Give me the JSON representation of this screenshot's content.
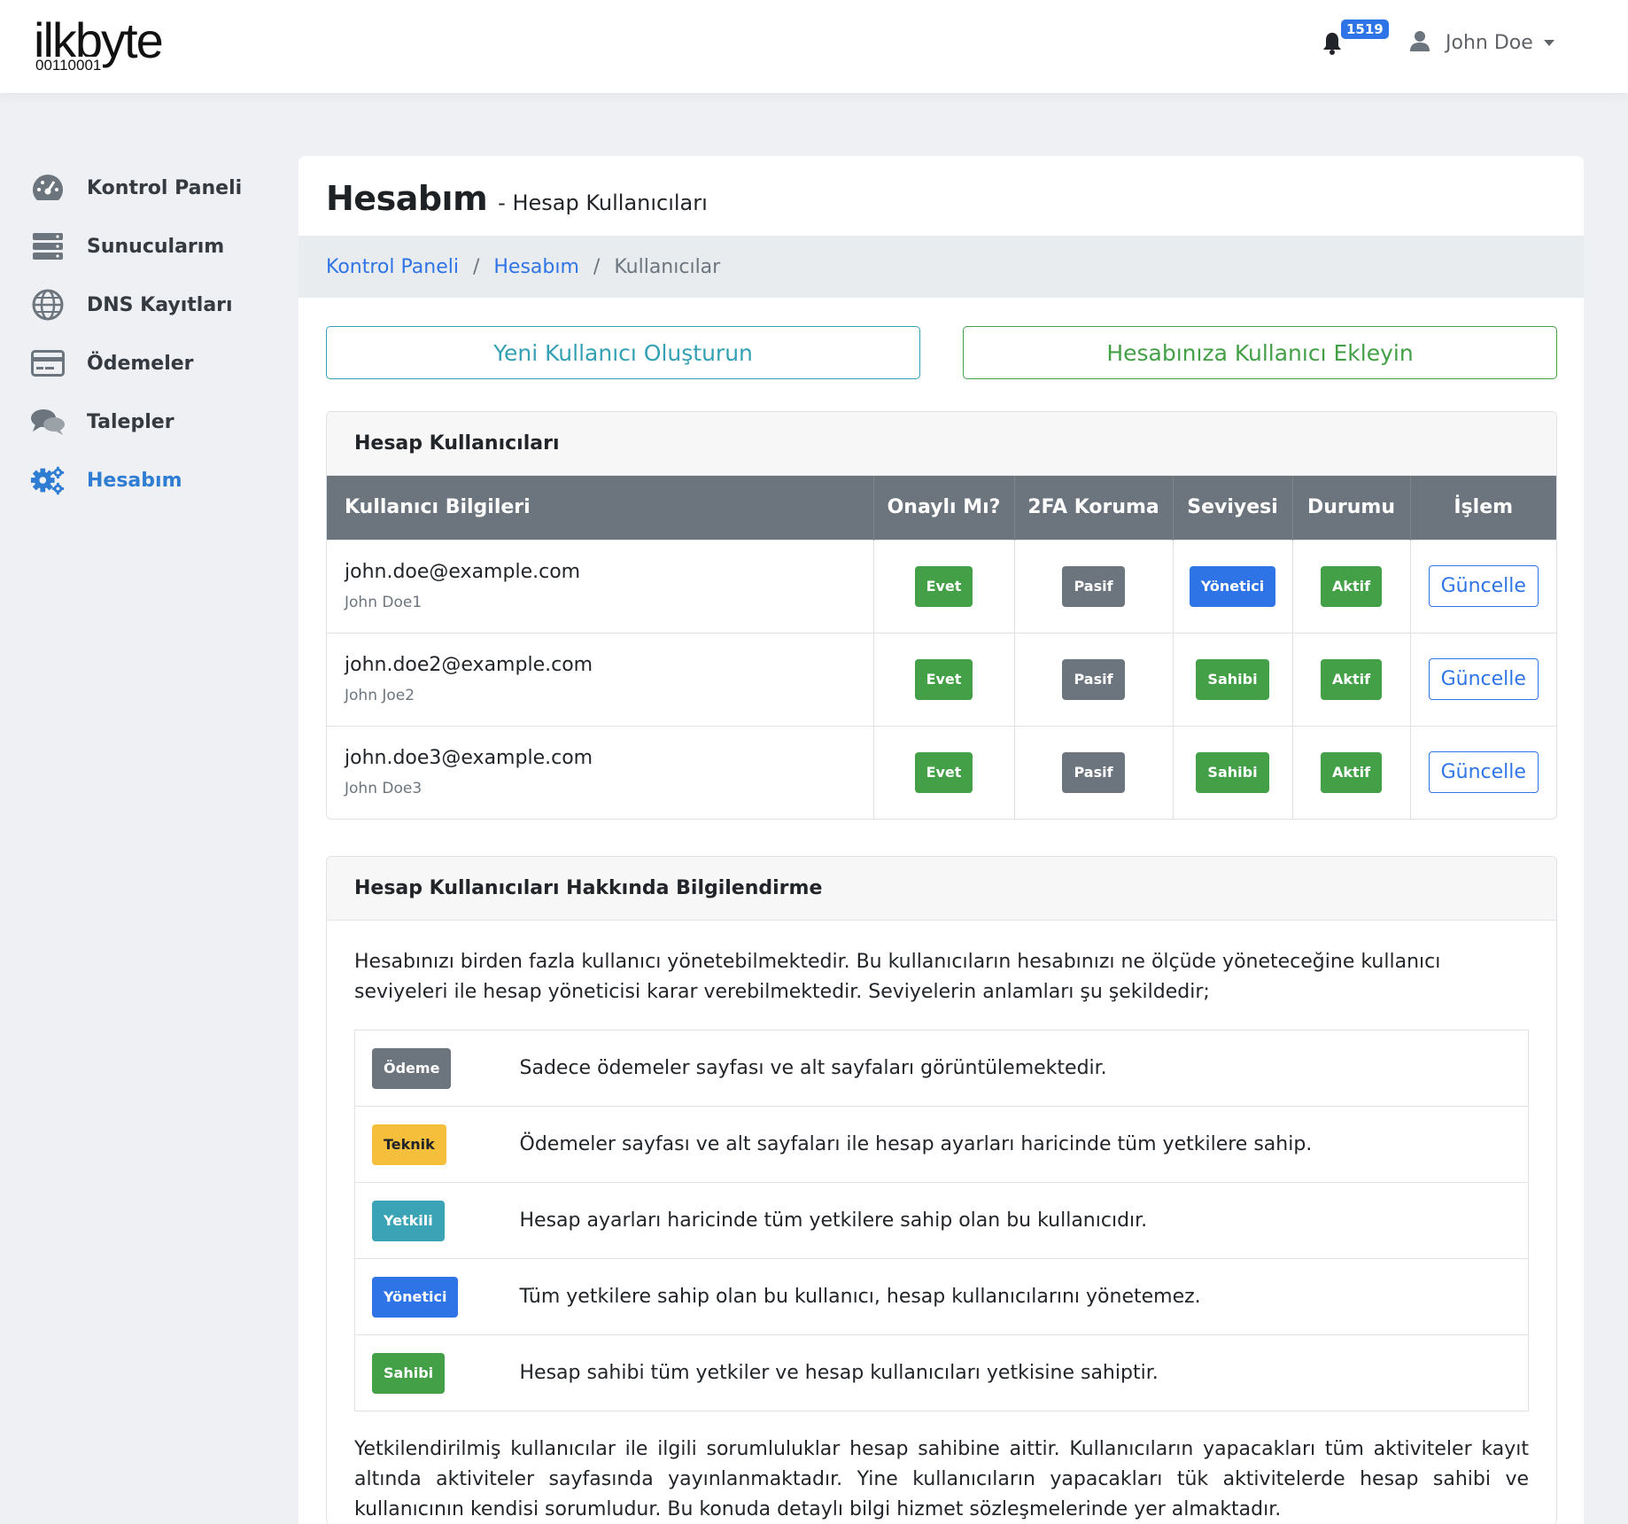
{
  "header": {
    "logo_text": "ilkbyte",
    "logo_subtext": "00110001",
    "notification_count": "1519",
    "user_name": "John Doe"
  },
  "sidebar": {
    "items": [
      {
        "label": "Kontrol Paneli",
        "icon": "dashboard-icon"
      },
      {
        "label": "Sunucularım",
        "icon": "server-icon"
      },
      {
        "label": "DNS Kayıtları",
        "icon": "globe-icon"
      },
      {
        "label": "Ödemeler",
        "icon": "credit-card-icon"
      },
      {
        "label": "Talepler",
        "icon": "comments-icon"
      },
      {
        "label": "Hesabım",
        "icon": "gears-icon",
        "active": true
      }
    ]
  },
  "page": {
    "title": "Hesabım",
    "subtitle": "- Hesap Kullanıcıları",
    "breadcrumb": [
      "Kontrol Paneli",
      "Hesabım",
      "Kullanıcılar"
    ],
    "buttons": {
      "create_user": "Yeni Kullanıcı Oluşturun",
      "add_user": "Hesabınıza Kullanıcı Ekleyin"
    }
  },
  "users_panel": {
    "title": "Hesap Kullanıcıları",
    "columns": [
      "Kullanıcı Bilgileri",
      "Onaylı Mı?",
      "2FA Koruma",
      "Seviyesi",
      "Durumu",
      "İşlem"
    ],
    "rows": [
      {
        "email": "john.doe@example.com",
        "name": "John Doe1",
        "approved": "Evet",
        "twofa": "Pasif",
        "level": "Yönetici",
        "status": "Aktif",
        "action": "Güncelle"
      },
      {
        "email": "john.doe2@example.com",
        "name": "John Joe2",
        "approved": "Evet",
        "twofa": "Pasif",
        "level": "Sahibi",
        "status": "Aktif",
        "action": "Güncelle"
      },
      {
        "email": "john.doe3@example.com",
        "name": "John Doe3",
        "approved": "Evet",
        "twofa": "Pasif",
        "level": "Sahibi",
        "status": "Aktif",
        "action": "Güncelle"
      }
    ]
  },
  "info_panel": {
    "title": "Hesap Kullanıcıları Hakkında Bilgilendirme",
    "intro": "Hesabınızı birden fazla kullanıcı yönetebilmektedir. Bu kullanıcıların hesabınızı ne ölçüde yöneteceğine kullanıcı seviyeleri ile hesap yöneticisi karar verebilmektedir. Seviyelerin anlamları şu şekildedir;",
    "levels": [
      {
        "badge": "Ödeme",
        "text": "Sadece ödemeler sayfası ve alt sayfaları görüntülemektedir."
      },
      {
        "badge": "Teknik",
        "text": "Ödemeler sayfası ve alt sayfaları ile hesap ayarları haricinde tüm yetkilere sahip."
      },
      {
        "badge": "Yetkili",
        "text": "Hesap ayarları haricinde tüm yetkilere sahip olan bu kullanıcıdır."
      },
      {
        "badge": "Yönetici",
        "text": "Tüm yetkilere sahip olan bu kullanıcı, hesap kullanıcılarını yönetemez."
      },
      {
        "badge": "Sahibi",
        "text": "Hesap sahibi tüm yetkiler ve hesap kullanıcıları yetkisine sahiptir."
      }
    ],
    "footer": "Yetkilendirilmiş kullanıcılar ile ilgili sorumluluklar hesap sahibine aittir. Kullanıcıların yapacakları tüm aktiviteler kayıt altında aktiviteler sayfasında yayınlanmaktadır. Yine kullanıcıların yapacakları tük aktivitelerde hesap sahibi ve kullanıcının kendisi sorumludur. Bu konuda detaylı bilgi hizmet sözleşmelerinde yer almaktadır."
  },
  "colors": {
    "primary": "#2f74e6",
    "success": "#43a047",
    "secondary": "#6c757d",
    "warning": "#f5bf3b",
    "info": "#3aa3b5",
    "sidebar_active": "#2f7cd3"
  }
}
